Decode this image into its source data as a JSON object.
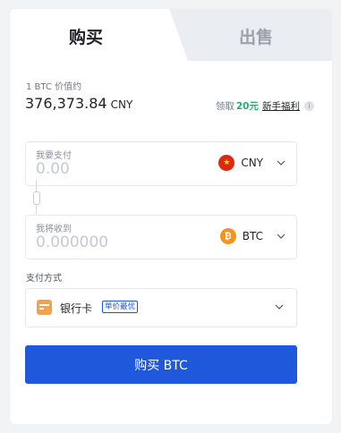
{
  "tabs": {
    "buy": "购买",
    "sell": "出售"
  },
  "price": {
    "caption": "1 BTC 价值约",
    "value": "376,373.84",
    "currency": "CNY"
  },
  "promo": {
    "prefix": "领取",
    "amount": "20元",
    "link": "新手福利",
    "info_glyph": "i"
  },
  "pay_field": {
    "label": "我要支付",
    "placeholder": "0.00",
    "currency": "CNY",
    "flag_icon": "cn-flag-icon"
  },
  "receive_field": {
    "label": "我将收到",
    "placeholder": "0.000000",
    "currency": "BTC",
    "coin_icon": "bitcoin-icon"
  },
  "payment_method": {
    "caption": "支付方式",
    "selected": "银行卡",
    "badge": "单价最优",
    "icon": "bank-card-icon"
  },
  "submit": {
    "label": "购买 BTC"
  },
  "colors": {
    "accent": "#1f58db",
    "promo_green": "#20b26c",
    "sell_tab_bg": "#eaedf2"
  }
}
